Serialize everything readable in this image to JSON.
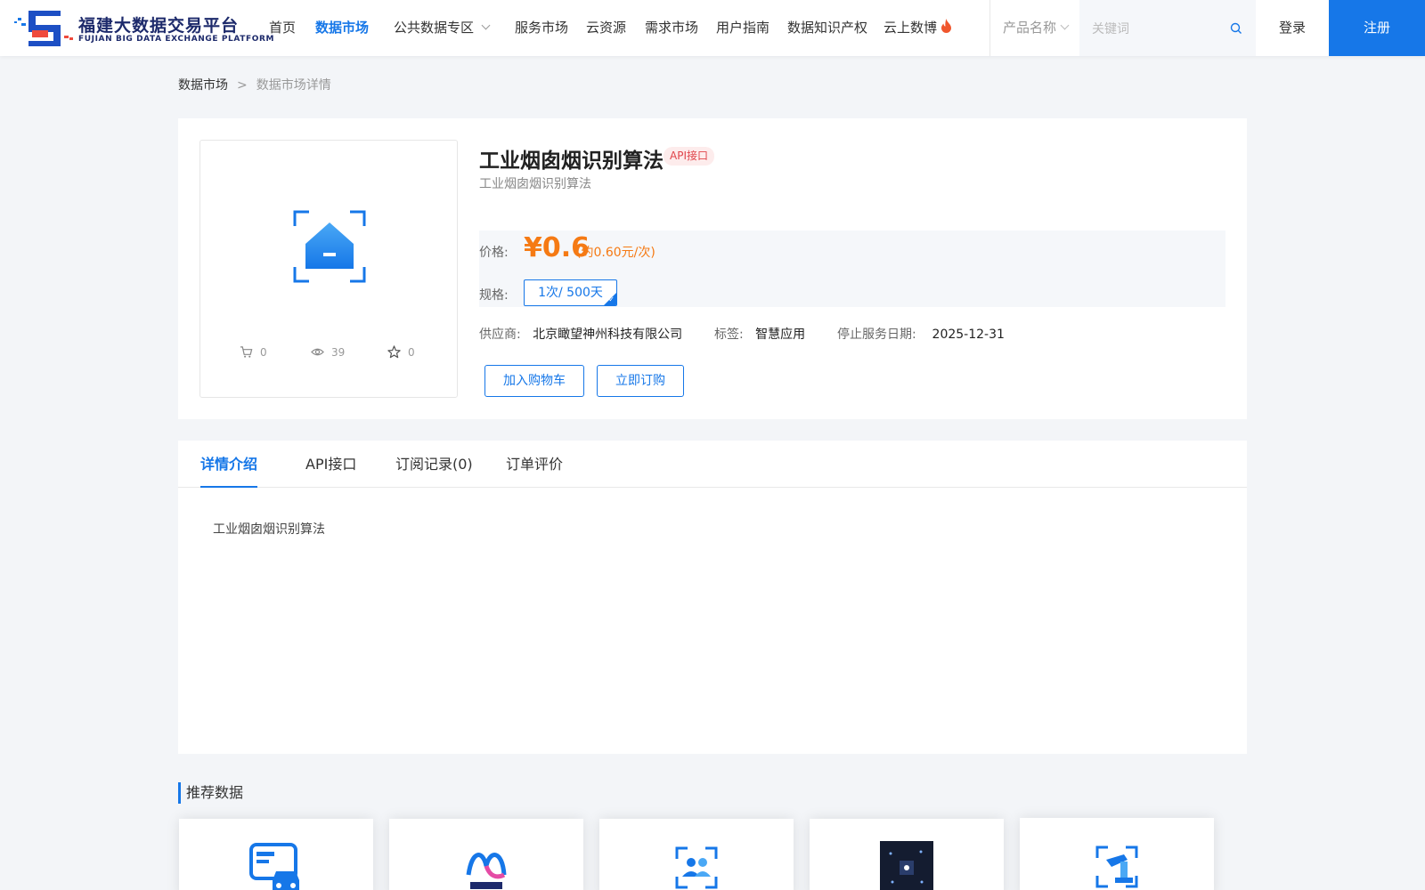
{
  "header": {
    "logo_cn": "福建大数据交易平台",
    "logo_en": "FUJIAN BIG DATA EXCHANGE  PLATFORM",
    "nav": [
      {
        "label": "首页",
        "active": false
      },
      {
        "label": "数据市场",
        "active": true
      },
      {
        "label": "公共数据专区",
        "dropdown": true
      },
      {
        "label": "服务市场"
      },
      {
        "label": "云资源"
      },
      {
        "label": "需求市场"
      },
      {
        "label": "用户指南"
      },
      {
        "label": "数据知识产权"
      },
      {
        "label": "云上数博",
        "icon": "fire-icon"
      }
    ],
    "search": {
      "category": "产品名称",
      "placeholder": "关键词"
    },
    "login": "登录",
    "register": "注册",
    "accent": "#1677e8"
  },
  "breadcrumb": [
    "数据市场",
    ">",
    "数据市场详情"
  ],
  "product": {
    "title": "工业烟囱烟识别算法",
    "tag": "API接口",
    "subtitle": "工业烟囱烟识别算法",
    "stats": {
      "cart": "0",
      "views": "39",
      "favorites": "0"
    },
    "price_label": "价格:",
    "price": "¥0.6",
    "price_note": "(约0.60元/次)",
    "spec_label": "规格:",
    "spec_value": "1次/ 500天",
    "supplier_label": "供应商:",
    "supplier": "北京瞰望神州科技有限公司",
    "tag_label": "标签:",
    "tag_value": "智慧应用",
    "stop_label": "停止服务日期:",
    "stop_date": "2025-12-31",
    "add_cart": "加入购物车",
    "subscribe": "立即订购",
    "price_color": "#f57a14"
  },
  "tabs": [
    {
      "label": "详情介绍",
      "active": true
    },
    {
      "label": "API接口"
    },
    {
      "label": "订阅记录(0)"
    },
    {
      "label": "订单评价"
    }
  ],
  "detail_text": "工业烟囱烟识别算法",
  "recommend": {
    "title": "推荐数据",
    "items": [
      {
        "icon": "card-car-icon"
      },
      {
        "icon": "anxin-logo-icon"
      },
      {
        "icon": "people-scan-icon"
      },
      {
        "icon": "chip-photo-icon"
      },
      {
        "icon": "robot-arm-icon"
      }
    ]
  }
}
